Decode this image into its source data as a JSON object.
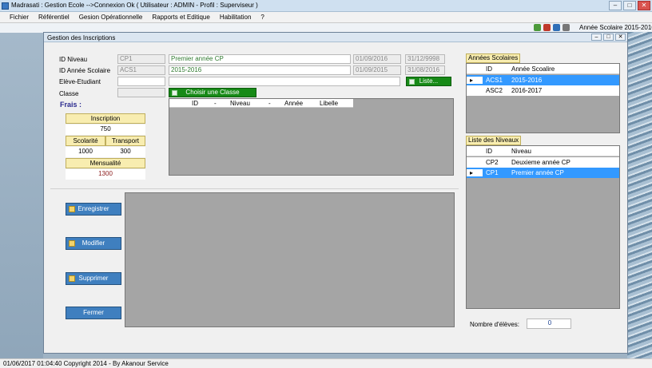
{
  "app": {
    "title": "Madrasati : Gestion Ecole -->Connexion Ok ( Utilisateur : ADMIN - Profil : Superviseur )",
    "min": "–",
    "max": "□",
    "close": "✕"
  },
  "menu": [
    "Fichier",
    "Référentiel",
    "Gesion Opérationnelle",
    "Rapports et Editique",
    "Habilitation",
    "?"
  ],
  "toolstrip": {
    "annee": "Année Scolaire 2015-2016"
  },
  "child": {
    "title": "Gestion des Inscriptions",
    "min": "–",
    "max": "□",
    "close": "✕",
    "labels": {
      "id_niveau": "ID Niveau",
      "id_annee": "ID Année Scolaire",
      "eleve": "Elève-Etudiant",
      "classe": "Classe"
    },
    "values": {
      "id_niveau": "CP1",
      "niveau_name": "Premier année CP",
      "niveau_debut": "01/09/2016",
      "niveau_fin": "31/12/9998",
      "id_annee": "ACS1",
      "annee_name": "2015-2016",
      "annee_debut": "01/09/2015",
      "annee_fin": "31/08/2016",
      "eleve": "",
      "classe": ""
    },
    "liste_button": "Liste...",
    "choisir_button": "Choisir une Classe",
    "classe_grid_headers": [
      "ID",
      "-",
      "Niveau",
      "-",
      "Année",
      "Libelle"
    ],
    "frais": {
      "title": "Frais :",
      "inscription_label": "Inscription",
      "inscription_value": "750",
      "scolarite_label": "Scolarité",
      "scolarite_value": "1000",
      "transport_label": "Transport",
      "transport_value": "300",
      "mensualite_label": "Mensualité",
      "mensualite_value": "1300"
    },
    "buttons": {
      "enregistrer": "Enregistrer",
      "modifier": "Modifier",
      "supprimer": "Supprimer",
      "fermer": "Fermer"
    },
    "annees": {
      "title": "Années Scolaires",
      "headers": [
        "ID",
        "Année Scoalire"
      ],
      "rows": [
        {
          "id": "ACS1",
          "annee": "2015-2016",
          "selected": true
        },
        {
          "id": "ASC2",
          "annee": "2016-2017",
          "selected": false
        }
      ]
    },
    "niveaux": {
      "title": "Liste des Niveaux",
      "headers": [
        "ID",
        "Niveau"
      ],
      "rows": [
        {
          "id": "CP2",
          "niveau": "Deuxieme année CP",
          "selected": false
        },
        {
          "id": "CP1",
          "niveau": "Premier année CP",
          "selected": true
        }
      ]
    },
    "nb_eleves_label": "Nombre d'élèves:",
    "nb_eleves_value": "0"
  },
  "status": {
    "text": "01/06/2017 01:04:40  Copyright 2014 - By Akanour Service"
  }
}
